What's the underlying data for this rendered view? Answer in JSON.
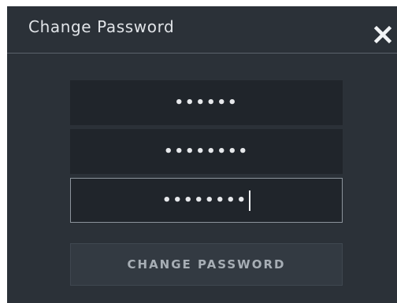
{
  "dialog": {
    "title": "Change Password",
    "close_icon": "close-icon"
  },
  "fields": {
    "current_password": "••••••",
    "new_password": "••••••••",
    "confirm_password": "••••••••"
  },
  "button": {
    "label": "CHANGE PASSWORD"
  },
  "colors": {
    "dialog_bg": "#2b3138",
    "field_bg": "#20252b",
    "button_bg": "#333a42",
    "text": "#e1e4e8",
    "button_text": "#a7aeb5"
  }
}
